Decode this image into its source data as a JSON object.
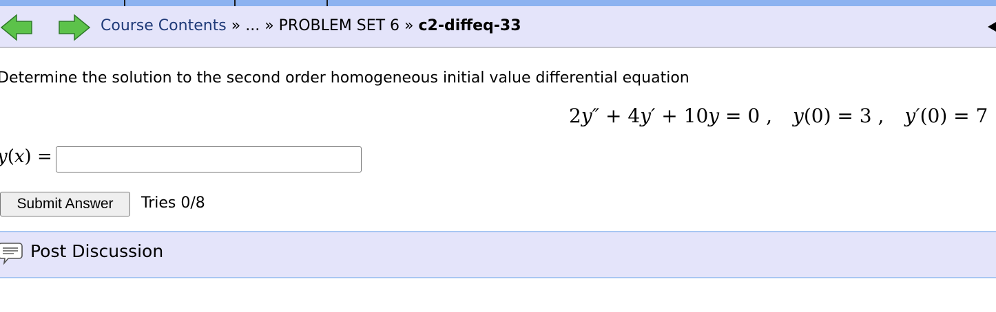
{
  "nav": {
    "back_icon": "green-left-arrow-icon",
    "forward_icon": "green-right-arrow-icon",
    "breadcrumb": {
      "course_contents": "Course Contents",
      "separator_1": " » ",
      "ellipsis": "...",
      "separator_2": " » ",
      "problem_set": "PROBLEM SET 6",
      "separator_3": " » ",
      "current": "c2-diffeq-33"
    },
    "colors": {
      "bar_bg": "#e4e4fa",
      "tab_strip": "#8cb2f0",
      "arrow_green": "#5cc24a"
    }
  },
  "problem": {
    "prompt": "Determine the solution to the second order homogeneous initial value differential equation",
    "equation": {
      "coef_a": "2",
      "var_a": "y″",
      "plus_1": " + ",
      "coef_b": "4",
      "var_b": "y′",
      "plus_2": " + ",
      "coef_c": "10",
      "var_c": "y",
      "equals_zero": " = 0",
      "comma_1": " ,",
      "ic1_var": "y",
      "ic1_rest": "(0) = 3",
      "comma_2": " ,",
      "ic2_var": "y′",
      "ic2_rest": "(0) = 7"
    },
    "answer": {
      "label_y": "y",
      "label_paren": "(",
      "label_x": "x",
      "label_close": ") =",
      "value": ""
    },
    "submit_label": "Submit Answer",
    "tries": "Tries 0/8"
  },
  "discussion": {
    "icon": "speech-bubble-icon",
    "label": "Post Discussion"
  }
}
